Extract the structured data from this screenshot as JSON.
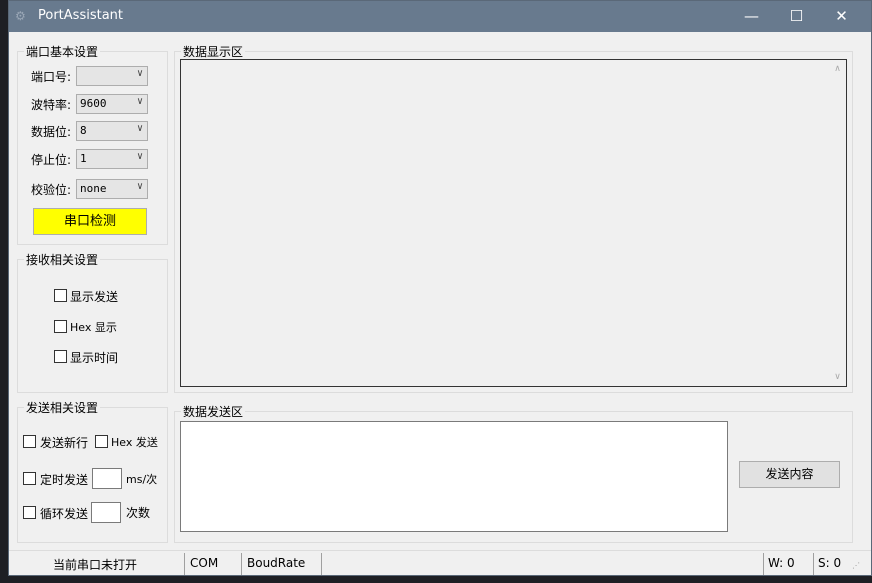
{
  "window": {
    "title": "PortAssistant",
    "minimize": "—",
    "maximize": "☐",
    "close": "✕"
  },
  "port_settings": {
    "title": "端口基本设置",
    "fields": [
      {
        "label": "端口号:",
        "value": ""
      },
      {
        "label": "波特率:",
        "value": "9600"
      },
      {
        "label": "数据位:",
        "value": "8"
      },
      {
        "label": "停止位:",
        "value": "1"
      },
      {
        "label": "校验位:",
        "value": "none"
      }
    ],
    "detect_button": "串口检测",
    "detect_color": "#ffff00"
  },
  "receive_settings": {
    "title": "接收相关设置",
    "options": [
      "显示发送",
      "Hex 显示",
      "显示时间"
    ]
  },
  "display": {
    "title": "数据显示区",
    "content": ""
  },
  "send_settings": {
    "title": "发送相关设置",
    "newline": "发送新行",
    "hex_send": "Hex 发送",
    "timed": "定时发送",
    "timed_value": "",
    "timed_unit": "ms/次",
    "loop": "循环发送",
    "loop_value": "",
    "loop_unit": "次数"
  },
  "send_area": {
    "title": "数据发送区",
    "content": "",
    "send_button": "发送内容"
  },
  "status": {
    "port_state": "当前串口未打开",
    "com": "COM",
    "baud": "BoudRate",
    "w": "W: 0",
    "s": "S: 0"
  }
}
